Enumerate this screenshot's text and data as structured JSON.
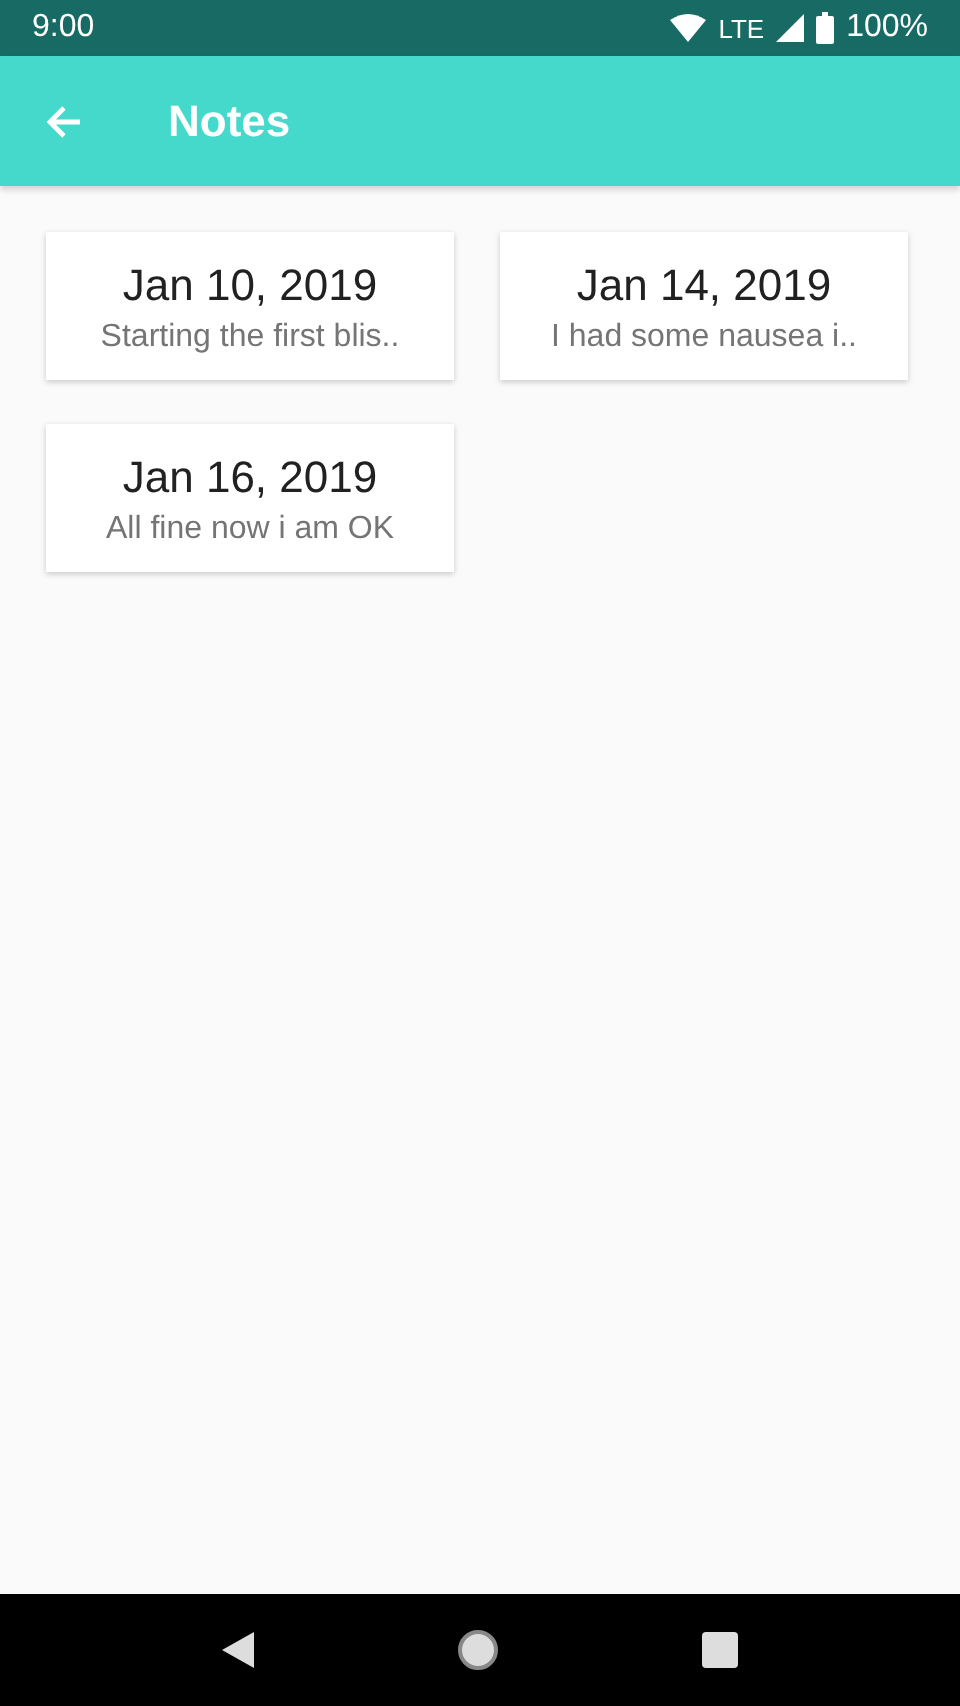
{
  "status_bar": {
    "time": "9:00",
    "network": "LTE",
    "battery": "100%"
  },
  "app_bar": {
    "title": "Notes"
  },
  "notes": [
    {
      "date": "Jan 10, 2019",
      "preview": "Starting the first blis.."
    },
    {
      "date": "Jan 14, 2019",
      "preview": "I had some nausea i.."
    },
    {
      "date": "Jan 16, 2019",
      "preview": "All fine now i am OK"
    }
  ]
}
